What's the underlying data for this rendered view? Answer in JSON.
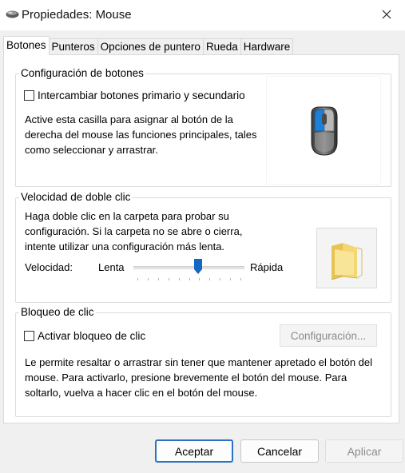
{
  "window": {
    "title": "Propiedades: Mouse",
    "close_icon": "close-icon",
    "app_icon": "mouse-icon"
  },
  "tabs": [
    {
      "label": "Botones",
      "active": true
    },
    {
      "label": "Punteros",
      "active": false
    },
    {
      "label": "Opciones de puntero",
      "active": false
    },
    {
      "label": "Rueda",
      "active": false
    },
    {
      "label": "Hardware",
      "active": false
    }
  ],
  "buttons_config": {
    "title": "Configuración de botones",
    "swap_checkbox_label": "Intercambiar botones primario y secundario",
    "swap_checked": false,
    "description": "Active esta casilla para asignar al botón de la derecha del mouse las funciones principales, tales como seleccionar y arrastrar.",
    "mouse_image_icon": "mouse-illustration-icon"
  },
  "double_click": {
    "title": "Velocidad de doble clic",
    "description": "Haga doble clic en la carpeta para probar su configuración. Si la carpeta no se abre o cierra, intente utilizar una configuración más lenta.",
    "speed_label": "Velocidad:",
    "slow_label": "Lenta",
    "fast_label": "Rápida",
    "speed_value": 0.58,
    "folder_icon": "folder-icon"
  },
  "click_lock": {
    "title": "Bloqueo de clic",
    "checkbox_label": "Activar bloqueo de clic",
    "checked": false,
    "config_button": "Configuración...",
    "description": "Le permite resaltar o arrastrar sin tener que mantener apretado el botón del mouse. Para activarlo, presione brevemente el botón del mouse. Para soltarlo, vuelva a hacer clic en el botón del mouse."
  },
  "footer": {
    "ok": "Aceptar",
    "cancel": "Cancelar",
    "apply": "Aplicar"
  },
  "colors": {
    "accent": "#2a73c5",
    "mouse_highlight": "#1e7fd8"
  }
}
